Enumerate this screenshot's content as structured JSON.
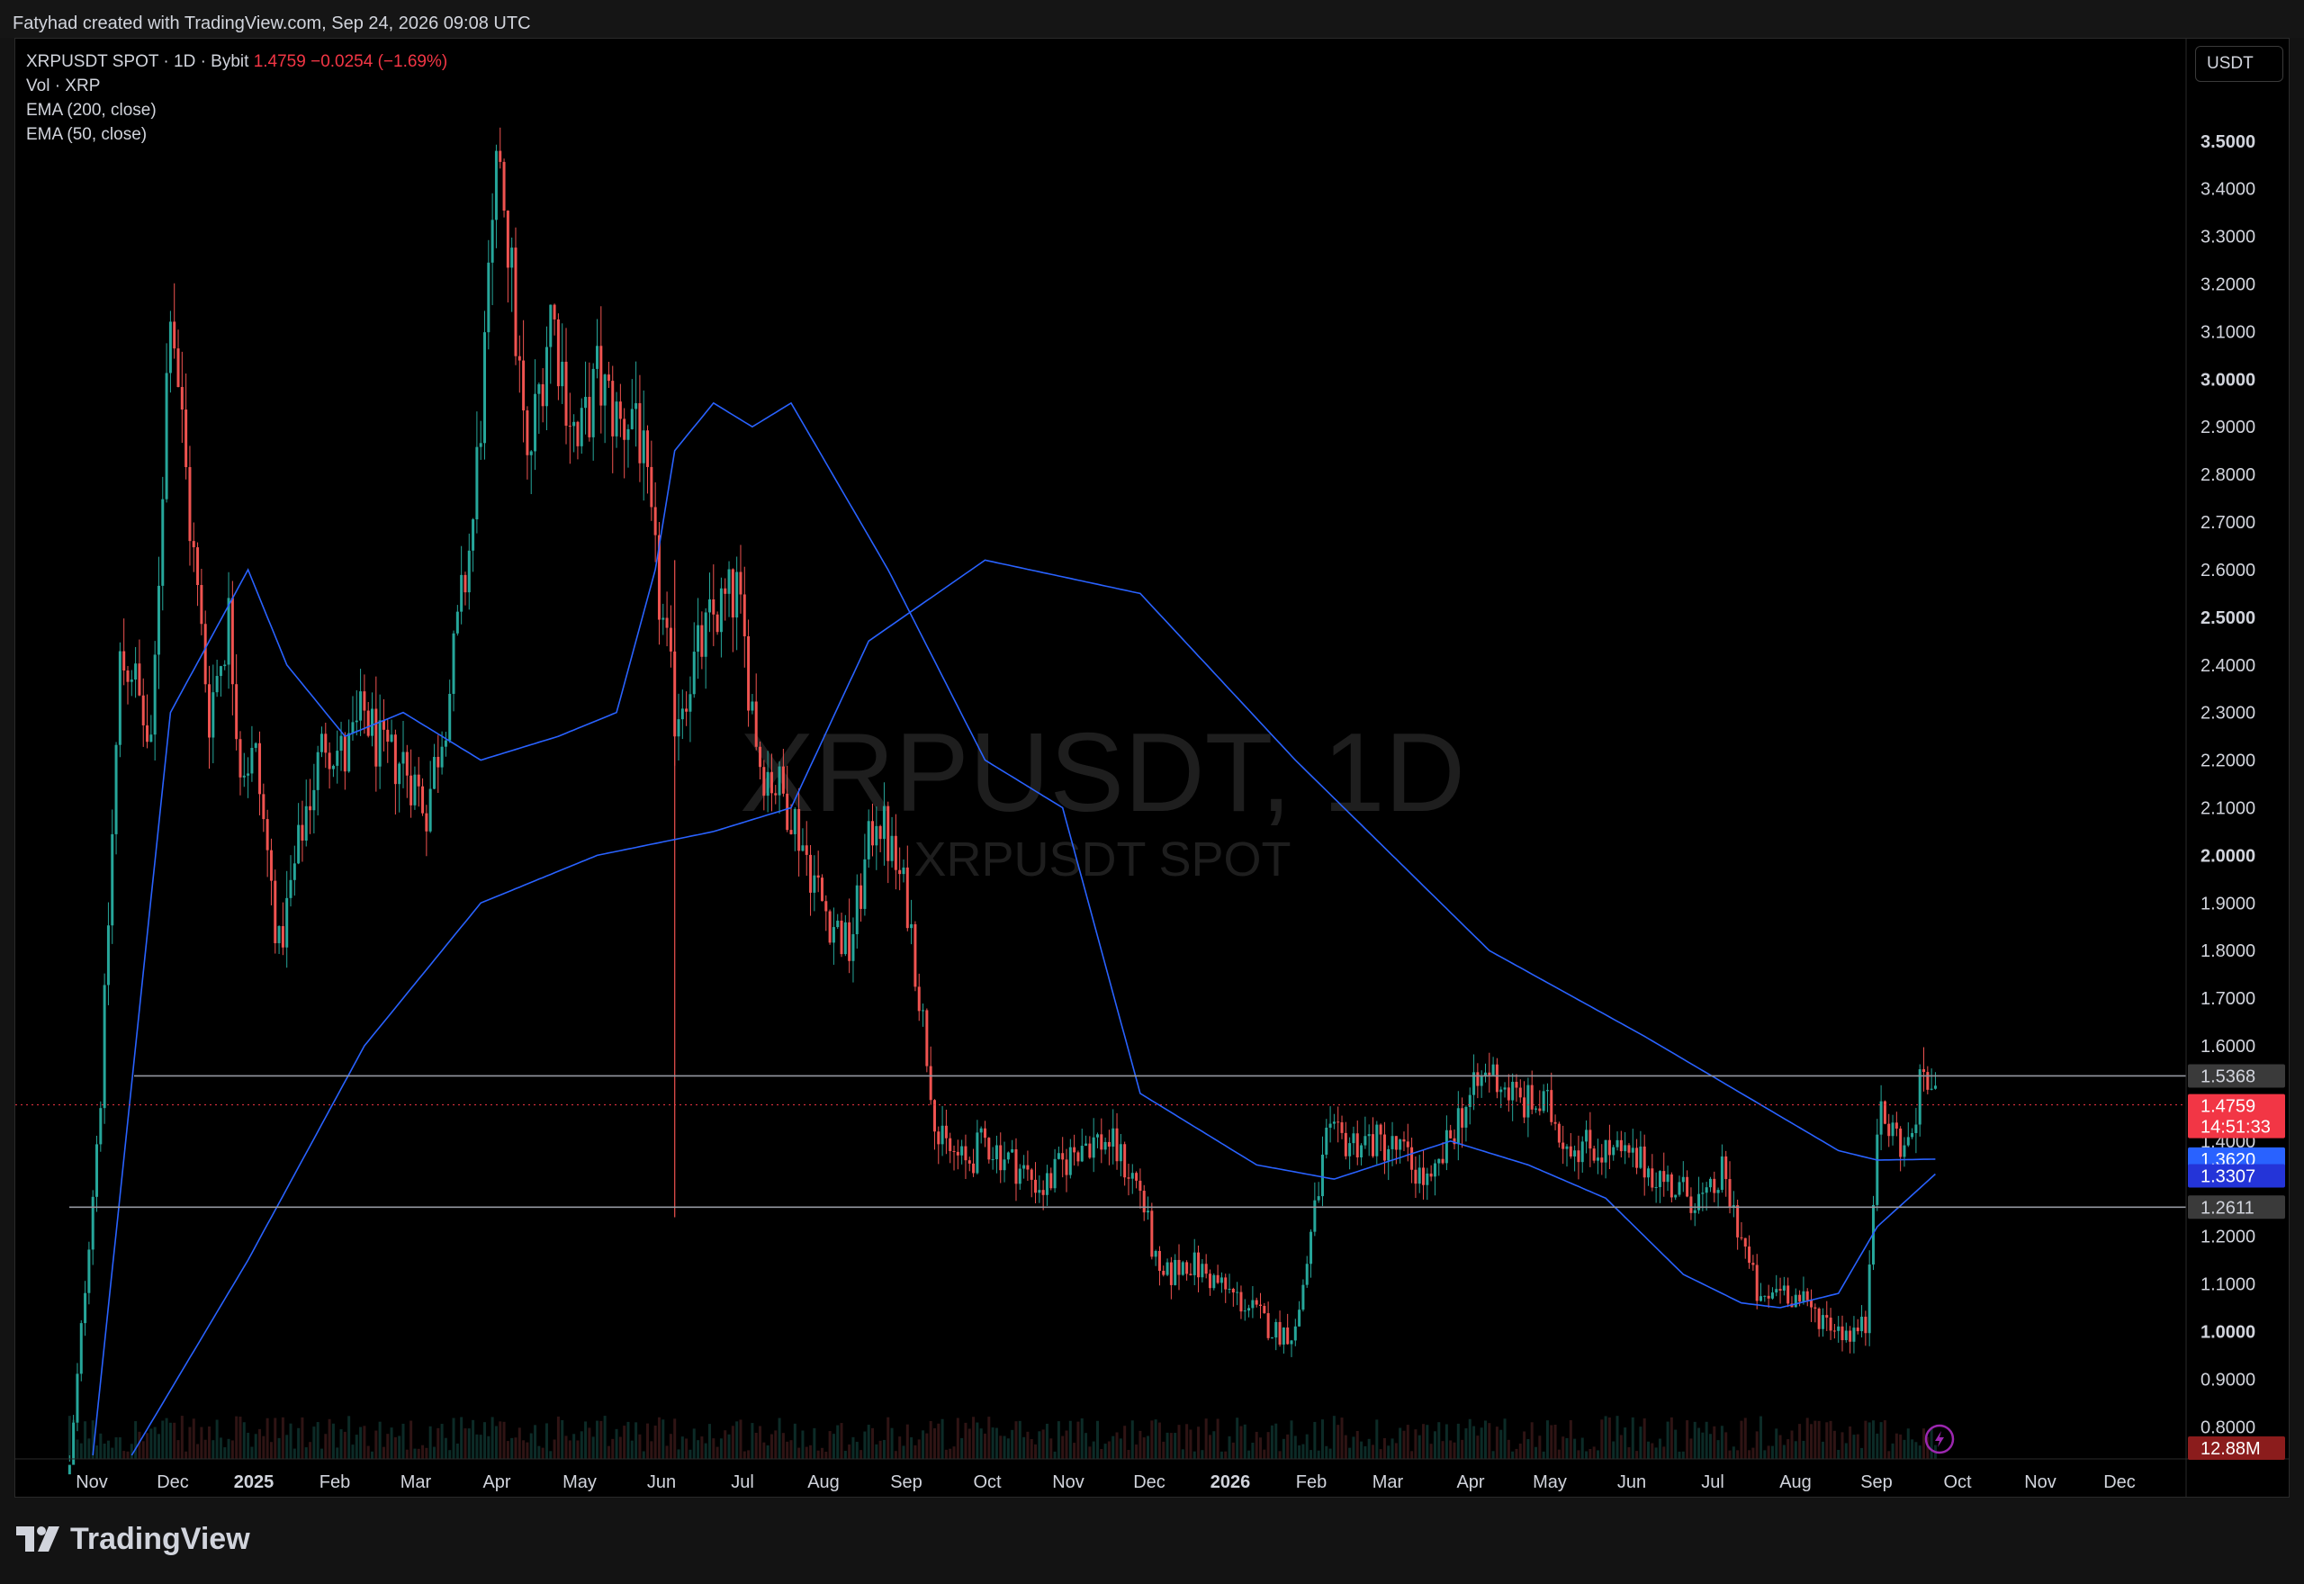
{
  "header": {
    "attribution": "Fatyhad created with TradingView.com, Sep 24, 2026 09:08 UTC"
  },
  "legend": {
    "symbol_line": "XRPUSDT SPOT · 1D · Bybit",
    "last_price": "1.4759",
    "change": "−0.0254 (−1.69%)",
    "volume": "Vol · XRP",
    "ema200": "EMA (200, close)",
    "ema50": "EMA (50, close)"
  },
  "currency_button": "USDT",
  "watermark": {
    "main": "XRPUSDT, 1D",
    "sub": "XRPUSDT SPOT"
  },
  "brand": "TradingView",
  "colors": {
    "up": "#26a69a",
    "down": "#ef5350",
    "ema": "#2962ff",
    "level": "#9598a1",
    "background": "#000000",
    "price_tag": "#f23645"
  },
  "chart_data": {
    "type": "candlestick",
    "title": "XRPUSDT SPOT · 1D · Bybit",
    "ylim": [
      0.74,
      3.7
    ],
    "y_ticks": [
      "3.5000",
      "3.4000",
      "3.3000",
      "3.2000",
      "3.1000",
      "3.0000",
      "2.9000",
      "2.8000",
      "2.7000",
      "2.6000",
      "2.5000",
      "2.4000",
      "2.3000",
      "2.2000",
      "2.1000",
      "2.0000",
      "1.9000",
      "1.8000",
      "1.7000",
      "1.6000",
      "1.4000",
      "1.2000",
      "1.1000",
      "1.0000",
      "0.9000",
      "0.8000"
    ],
    "x_ticks": [
      "Nov",
      "Dec",
      "2025",
      "Feb",
      "Mar",
      "Apr",
      "May",
      "Jun",
      "Jul",
      "Aug",
      "Sep",
      "Oct",
      "Nov",
      "Dec",
      "2026",
      "Feb",
      "Mar",
      "Apr",
      "May",
      "Jun",
      "Jul",
      "Aug",
      "Sep",
      "Oct",
      "Nov",
      "Dec"
    ],
    "price_anchors": {
      "x": [
        0,
        14,
        18,
        22,
        27,
        30,
        35,
        40,
        45,
        50,
        55,
        58,
        62,
        68,
        75,
        80,
        85,
        90,
        95,
        100,
        106,
        112,
        118,
        125,
        132,
        138,
        145,
        150,
        156,
        160,
        165,
        170,
        180,
        186,
        192,
        200,
        208,
        215,
        222,
        230,
        238,
        245,
        250,
        258,
        265,
        270,
        275,
        282,
        290,
        295,
        302,
        310,
        318,
        325,
        330,
        338,
        345,
        350,
        357,
        365,
        372,
        380,
        388,
        395,
        400,
        410,
        420,
        428,
        436,
        440,
        445,
        450,
        455,
        462,
        468,
        470,
        472,
        474,
        477,
        480,
        484,
        488,
        492,
        495
      ],
      "close": [
        0.7,
        0.7,
        1.1,
        1.5,
        2.4,
        2.4,
        2.2,
        3.2,
        2.7,
        2.3,
        2.5,
        2.2,
        2.2,
        1.8,
        2.1,
        2.25,
        2.2,
        2.3,
        2.2,
        2.2,
        2.1,
        2.35,
        2.7,
        3.5,
        2.8,
        3.15,
        2.85,
        3.0,
        2.9,
        2.95,
        2.6,
        2.3,
        2.5,
        2.55,
        2.2,
        2.1,
        1.9,
        1.8,
        2.1,
        1.9,
        1.4,
        1.35,
        1.4,
        1.35,
        1.3,
        1.35,
        1.4,
        1.4,
        1.3,
        1.1,
        1.15,
        1.1,
        1.05,
        1.0,
        1.0,
        1.4,
        1.4,
        1.4,
        1.38,
        1.3,
        1.45,
        1.55,
        1.48,
        1.47,
        1.4,
        1.38,
        1.35,
        1.3,
        1.27,
        1.33,
        1.2,
        1.05,
        1.1,
        1.05,
        1.02,
        1.01,
        1.0,
        1.0,
        1.01,
        1.45,
        1.42,
        1.38,
        1.55,
        1.48
      ]
    },
    "series": [
      {
        "name": "EMA (200, close)",
        "anchors": {
          "x": [
            30,
            60,
            90,
            120,
            150,
            180,
            200,
            220,
            250,
            290,
            330,
            380,
            420,
            470,
            480,
            495
          ],
          "y": [
            0.74,
            1.15,
            1.6,
            1.9,
            2.0,
            2.05,
            2.1,
            2.45,
            2.62,
            2.55,
            2.2,
            1.8,
            1.62,
            1.38,
            1.36,
            1.362
          ]
        }
      },
      {
        "name": "EMA (50, close)",
        "anchors": {
          "x": [
            20,
            40,
            60,
            70,
            85,
            100,
            120,
            140,
            155,
            165,
            170,
            180,
            190,
            200,
            225,
            250,
            270,
            290,
            320,
            340,
            370,
            390,
            410,
            430,
            445,
            455,
            470,
            480,
            495
          ],
          "y": [
            0.74,
            2.3,
            2.6,
            2.4,
            2.25,
            2.3,
            2.2,
            2.25,
            2.3,
            2.6,
            2.85,
            2.95,
            2.9,
            2.95,
            2.6,
            2.2,
            2.1,
            1.5,
            1.35,
            1.32,
            1.4,
            1.35,
            1.28,
            1.12,
            1.06,
            1.05,
            1.08,
            1.22,
            1.3307
          ]
        }
      }
    ],
    "levels": [
      {
        "label": "1.5368",
        "value": 1.5368
      },
      {
        "label": "1.2611",
        "value": 1.2611
      }
    ],
    "price_labels": [
      {
        "label": "1.4759",
        "value": 1.4759
      },
      {
        "label": "14:51:33",
        "value": 1.435
      },
      {
        "label": "1.3620",
        "value": 1.362
      },
      {
        "label": "1.3307",
        "value": 1.3307
      }
    ],
    "volume_label": "12.88M",
    "grid": false,
    "legend_position": "top-left"
  }
}
